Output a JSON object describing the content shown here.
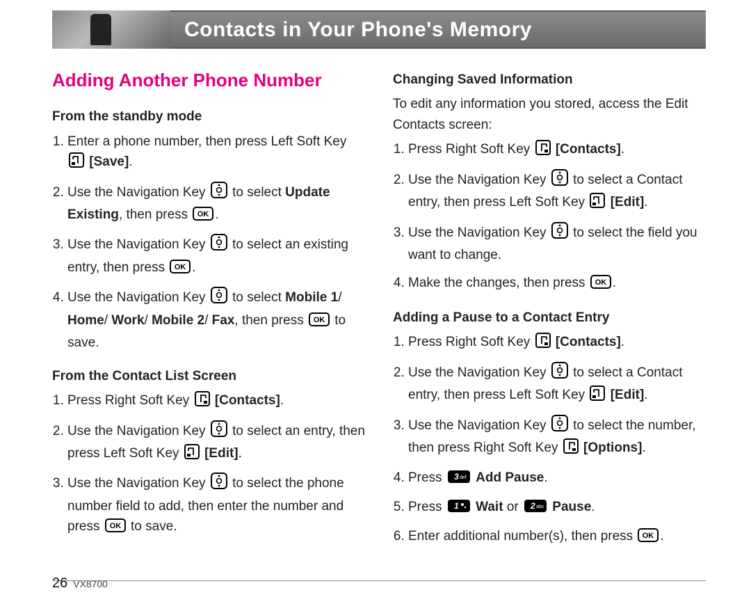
{
  "banner": {
    "title": "Contacts in Your Phone's Memory"
  },
  "section_title": "Adding Another Phone Number",
  "left": {
    "sub1": "From the standby mode",
    "s1": {
      "i1a": "Enter a phone number, then press Left Soft Key ",
      "i1b": "[Save]",
      "i1c": ".",
      "i2a": "Use the Navigation Key ",
      "i2b": " to select ",
      "i2c": "Update Existing",
      "i2d": ", then press ",
      "i2e": ".",
      "i3a": "Use the Navigation Key ",
      "i3b": " to select an existing entry, then press ",
      "i3c": ".",
      "i4a": "Use the Navigation Key ",
      "i4b": " to select ",
      "i4c": "Mobile 1",
      "i4d": "/ ",
      "i4e": "Home",
      "i4f": "/ ",
      "i4g": "Work",
      "i4h": "/ ",
      "i4i": "Mobile 2",
      "i4j": "/ ",
      "i4k": "Fax",
      "i4l": ", then press ",
      "i4m": " to save."
    },
    "sub2": "From the Contact List Screen",
    "s2": {
      "i1a": "Press Right Soft Key ",
      "i1b": "[Contacts]",
      "i1c": ".",
      "i2a": "Use the Navigation Key ",
      "i2b": " to select an entry, then press Left Soft Key ",
      "i2c": "[Edit]",
      "i2d": ".",
      "i3a": "Use the Navigation Key ",
      "i3b": " to select the phone number field to add, then enter the number and press ",
      "i3c": " to save."
    }
  },
  "right": {
    "sub1": "Changing Saved Information",
    "intro": "To edit any information you stored, access the Edit Contacts screen:",
    "s1": {
      "i1a": "Press Right Soft Key ",
      "i1b": "[Contacts]",
      "i1c": ".",
      "i2a": "Use the Navigation Key ",
      "i2b": " to select a Contact entry, then press Left Soft Key ",
      "i2c": "[Edit]",
      "i2d": ".",
      "i3a": "Use the Navigation Key ",
      "i3b": " to select the field you want to change.",
      "i4a": "Make the changes, then press ",
      "i4b": "."
    },
    "sub2": "Adding a Pause to a Contact Entry",
    "s2": {
      "i1a": "Press Right Soft Key ",
      "i1b": "[Contacts]",
      "i1c": ".",
      "i2a": "Use the Navigation Key ",
      "i2b": " to select a Contact entry, then press Left Soft Key ",
      "i2c": "[Edit]",
      "i2d": ".",
      "i3a": "Use the Navigation Key ",
      "i3b": " to select the number, then press Right Soft Key ",
      "i3c": "[Options]",
      "i3d": ".",
      "i4a": "Press ",
      "i4b": "Add Pause",
      "i4c": ".",
      "i5a": "Press ",
      "i5b": "Wait",
      "i5c": " or ",
      "i5d": "Pause",
      "i5e": ".",
      "i6a": "Enter additional number(s), then press ",
      "i6b": "."
    }
  },
  "keys": {
    "k1": "1",
    "k2": "2",
    "k3": "3",
    "k1sub": "",
    "k2sub": "abc",
    "k3sub": "def"
  },
  "footer": {
    "page": "26",
    "model": "VX8700"
  }
}
